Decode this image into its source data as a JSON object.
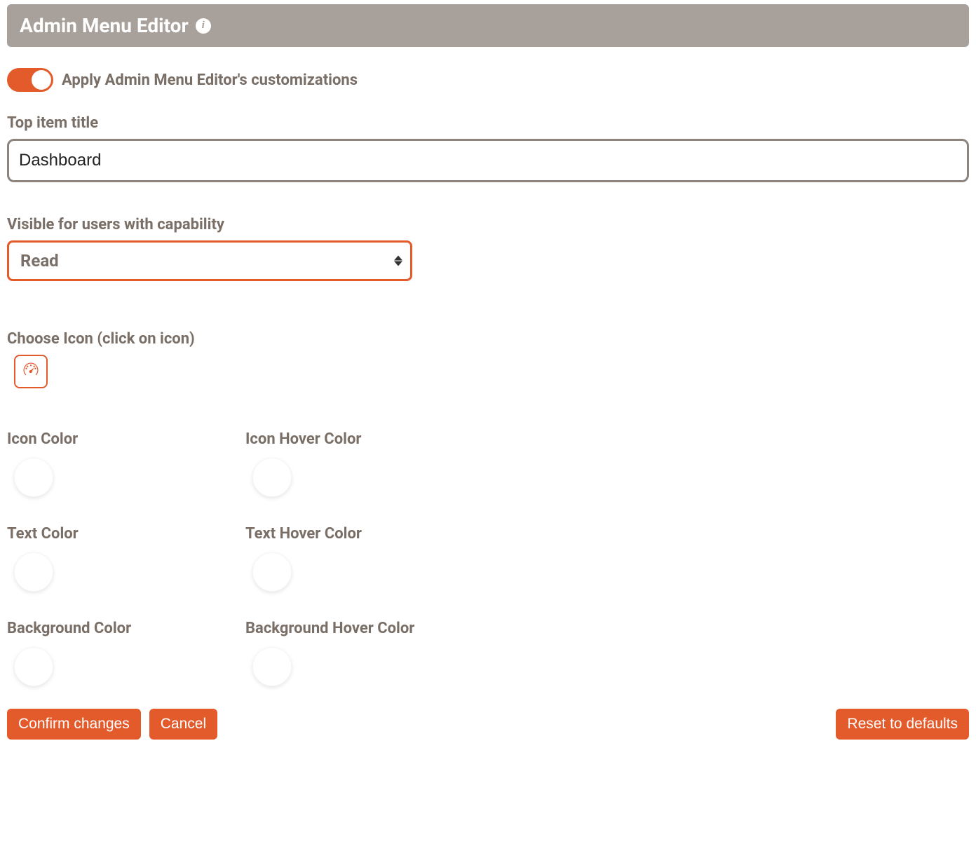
{
  "header": {
    "title": "Admin Menu Editor"
  },
  "toggle": {
    "label": "Apply Admin Menu Editor's customizations",
    "on": true
  },
  "fields": {
    "top_item_title_label": "Top item title",
    "top_item_title_value": "Dashboard",
    "capability_label": "Visible for users with capability",
    "capability_value": "Read",
    "choose_icon_label": "Choose Icon (click on icon)"
  },
  "colors": {
    "icon_color_label": "Icon Color",
    "icon_hover_color_label": "Icon Hover Color",
    "text_color_label": "Text Color",
    "text_hover_color_label": "Text Hover Color",
    "background_color_label": "Background Color",
    "background_hover_color_label": "Background Hover Color"
  },
  "buttons": {
    "confirm": "Confirm changes",
    "cancel": "Cancel",
    "reset": "Reset to defaults"
  },
  "theme": {
    "accent": "#e35a2b"
  }
}
